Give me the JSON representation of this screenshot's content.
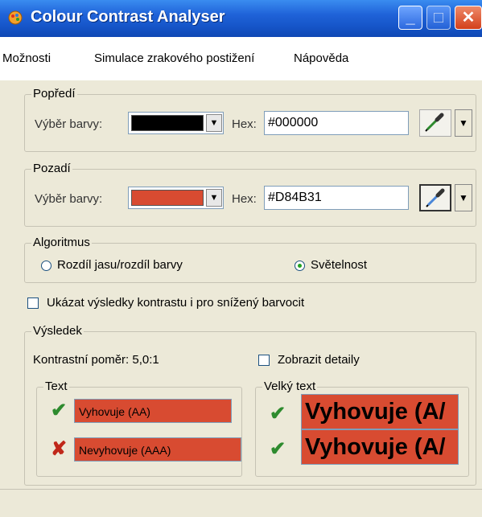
{
  "window": {
    "title": "Colour Contrast Analyser"
  },
  "menu": [
    "Možnosti",
    "Simulace zrakového postižení",
    "Nápověda"
  ],
  "foreground": {
    "legend": "Popředí",
    "color_label": "Výběr barvy:",
    "hex_label": "Hex:",
    "hex_value": "#000000",
    "color": "#000000"
  },
  "background": {
    "legend": "Pozadí",
    "color_label": "Výběr barvy:",
    "hex_label": "Hex:",
    "hex_value": "#D84B31",
    "color": "#D84B31"
  },
  "algorithm": {
    "legend": "Algoritmus",
    "options": [
      "Rozdíl jasu/rozdíl barvy",
      "Světelnost"
    ],
    "selected_index": 1
  },
  "show_reduced": {
    "label": "Ukázat výsledky kontrastu i pro snížený barvocit",
    "checked": false
  },
  "result": {
    "legend": "Výsledek",
    "ratio_text": "Kontrastní poměr: 5,0:1",
    "details_label": "Zobrazit detaily",
    "details_checked": false,
    "text_group": {
      "legend": "Text",
      "items": [
        {
          "status": "pass",
          "icon": "check-icon",
          "label": "Vyhovuje (AA)"
        },
        {
          "status": "fail",
          "icon": "cross-icon",
          "label": "Nevyhovuje (AAA)"
        }
      ]
    },
    "large_group": {
      "legend": "Velký text",
      "items": [
        {
          "status": "pass",
          "icon": "check-icon",
          "label": "Vyhovuje (A/"
        },
        {
          "status": "pass",
          "icon": "check-icon",
          "label": "Vyhovuje (A/"
        }
      ]
    }
  },
  "colors": {
    "pass": "#2e8b2e",
    "fail": "#c0281a",
    "sample_bg": "#D84B31"
  }
}
